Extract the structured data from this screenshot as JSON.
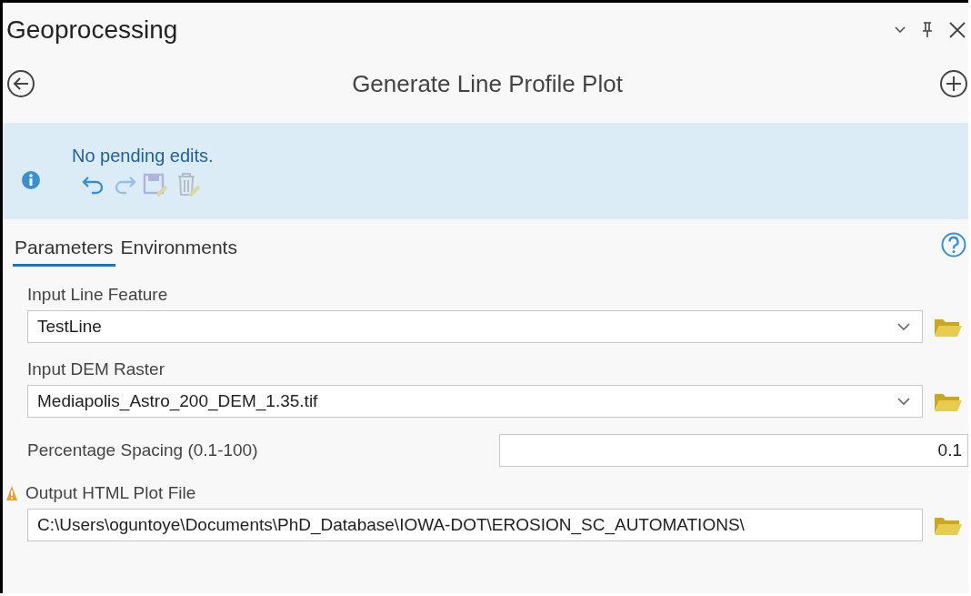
{
  "window": {
    "title": "Geoprocessing"
  },
  "tool": {
    "title": "Generate Line Profile Plot"
  },
  "edits": {
    "message": "No pending edits.",
    "buttons": [
      {
        "kind": "undo",
        "disabled": false
      },
      {
        "kind": "redo",
        "disabled": true
      },
      {
        "kind": "save",
        "disabled": true
      },
      {
        "kind": "discard",
        "disabled": true
      }
    ]
  },
  "tabs": [
    {
      "label": "Parameters",
      "selected": true
    },
    {
      "label": "Environments",
      "selected": false
    }
  ],
  "parameters": [
    {
      "kind": "dropdown",
      "label": "Input Line Feature",
      "value": "TestLine",
      "warning": false
    },
    {
      "kind": "dropdown",
      "label": "Input DEM Raster",
      "value": "Mediapolis_Astro_200_DEM_1.35.tif",
      "warning": false
    },
    {
      "kind": "number",
      "label": "Percentage Spacing (0.1-100)",
      "value": "0.1",
      "warning": false
    },
    {
      "kind": "path",
      "label": "Output HTML Plot File",
      "value": "C:\\Users\\oguntoye\\Documents\\PhD_Database\\IOWA-DOT\\EROSION_SC_AUTOMATIONS\\",
      "warning": true
    }
  ]
}
